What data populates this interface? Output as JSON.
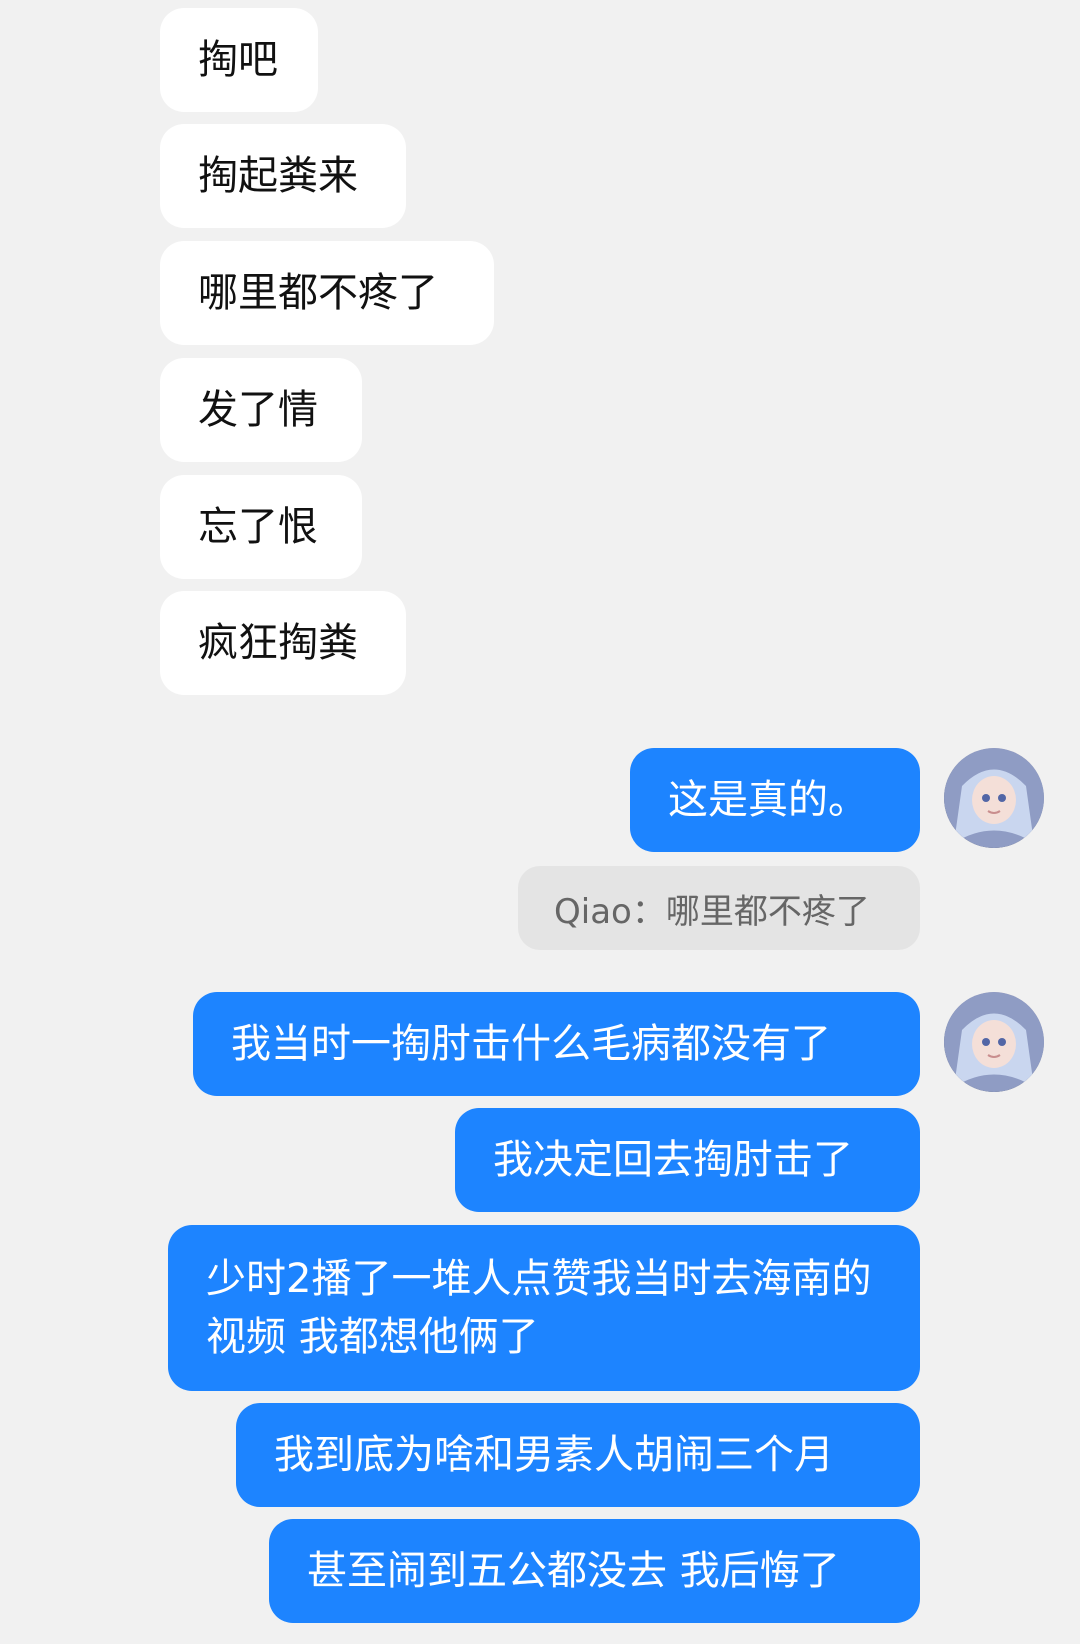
{
  "incoming_messages": [
    {
      "text": "掏吧"
    },
    {
      "text": "掏起粪来"
    },
    {
      "text": "哪里都不疼了"
    },
    {
      "text": "发了情"
    },
    {
      "text": "忘了恨"
    },
    {
      "text": "疯狂掏粪"
    }
  ],
  "outgoing_messages": [
    {
      "text": "这是真的。"
    },
    {
      "text": "我当时一掏肘击什么毛病都没有了"
    },
    {
      "text": "我决定回去掏肘击了"
    },
    {
      "text": "少时2播了一堆人点赞我当时去海南的视频 我都想他俩了"
    },
    {
      "text": "我到底为啥和男素人胡闹三个月"
    },
    {
      "text": "甚至闹到五公都没去 我后悔了"
    }
  ],
  "quote": {
    "text": "Qiao：哪里都不疼了"
  },
  "avatar": {
    "icon": "anime-avatar-icon"
  },
  "colors": {
    "background": "#f1f1f1",
    "incoming_bubble": "#ffffff",
    "outgoing_bubble": "#1d84ff",
    "quote_bubble": "#e4e4e4"
  }
}
